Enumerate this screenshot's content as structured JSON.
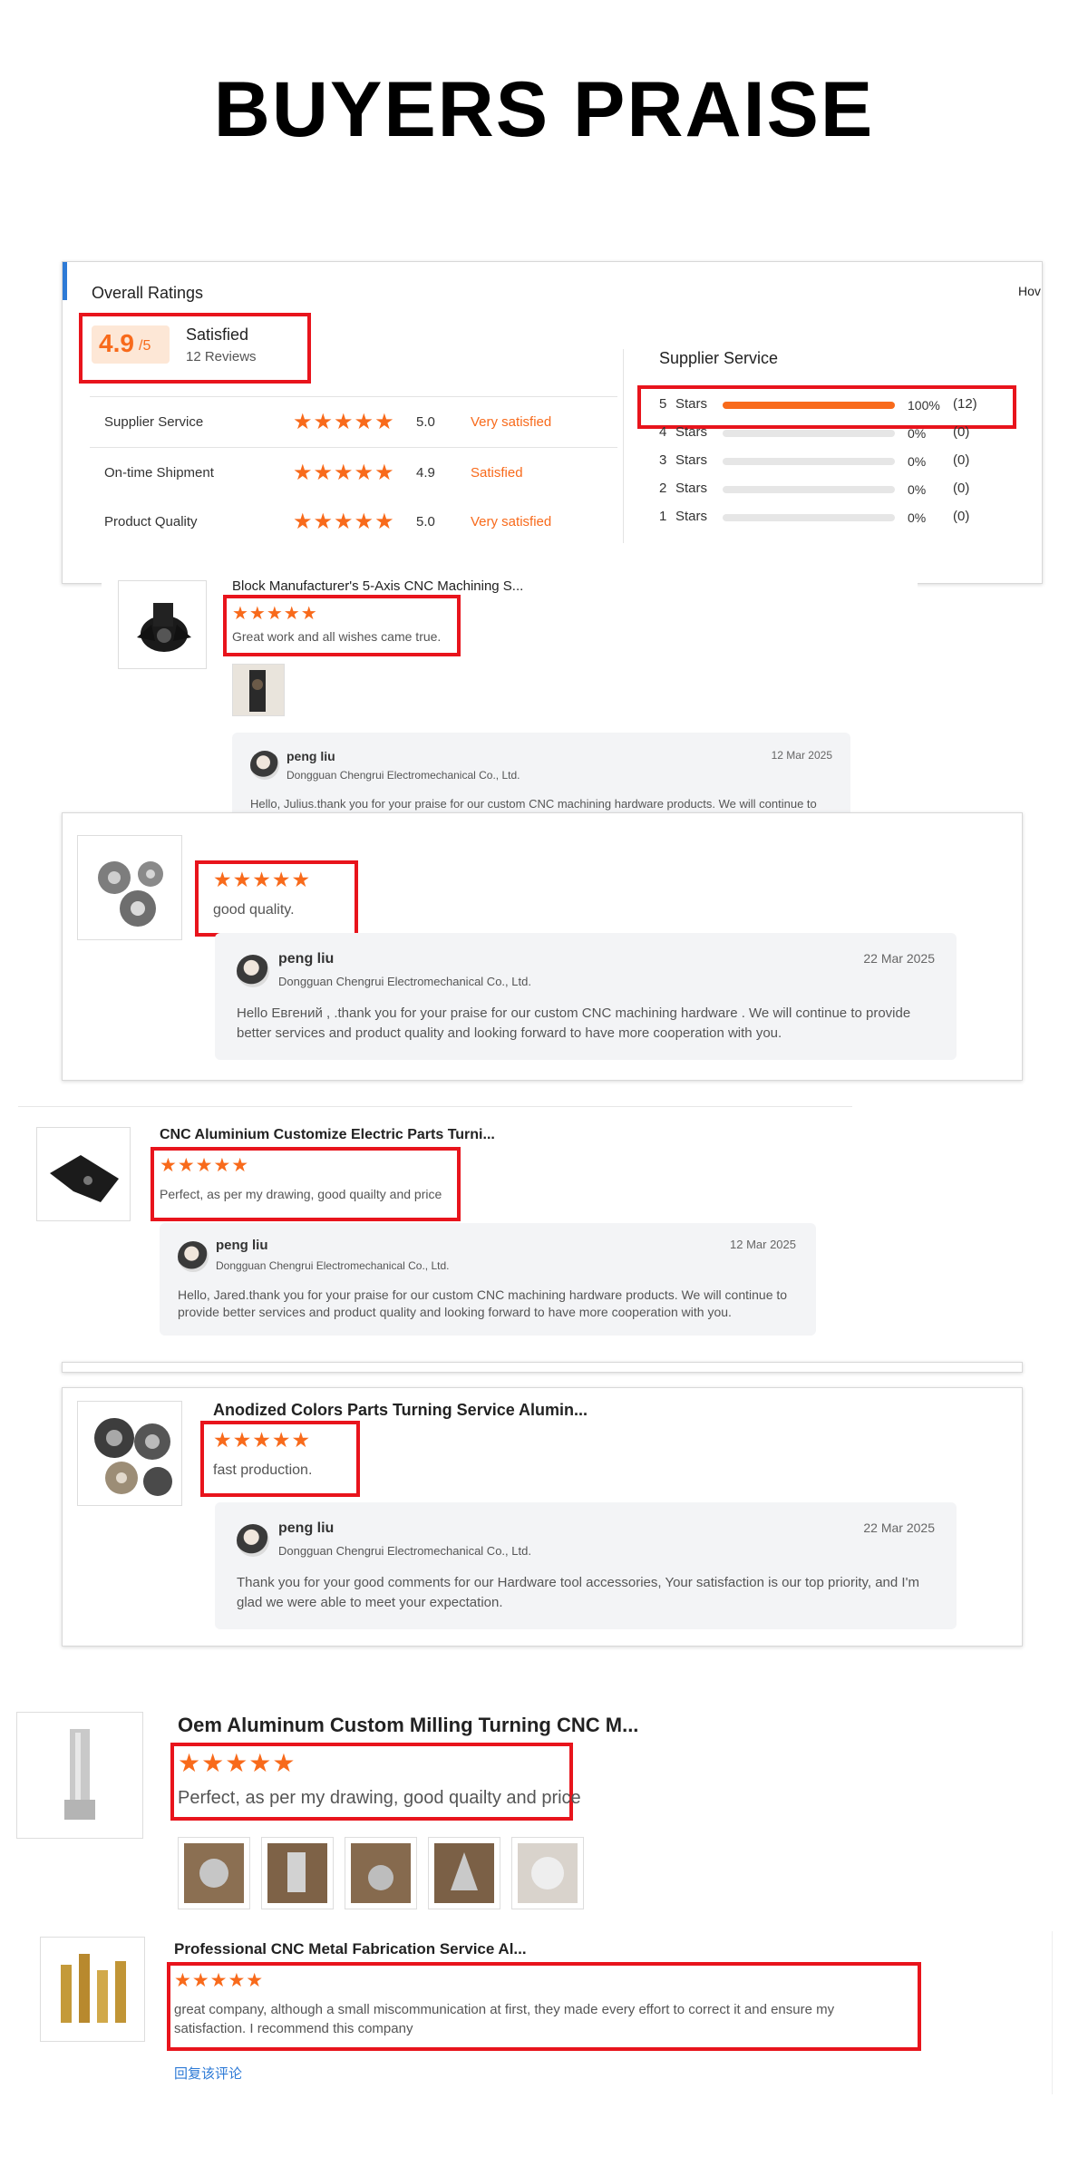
{
  "header": {
    "title": "BUYERS PRAISE"
  },
  "ratings": {
    "heading": "Overall Ratings",
    "score": "4.9",
    "score_suffix": "/5",
    "label": "Satisfied",
    "reviews": "12 Reviews",
    "how_cut": "Hov",
    "rows": [
      {
        "name": "Supplier Service",
        "stars": "★★★★★",
        "value": "5.0",
        "status": "Very satisfied"
      },
      {
        "name": "On-time Shipment",
        "stars": "★★★★★",
        "value": "4.9",
        "status": "Satisfied"
      },
      {
        "name": "Product Quality",
        "stars": "★★★★★",
        "value": "5.0",
        "status": "Very satisfied"
      }
    ],
    "supplier": {
      "heading": "Supplier Service",
      "rows": [
        {
          "stars": "5",
          "label": "Stars",
          "percent": "100%",
          "count": "(12)",
          "fill": 1.0
        },
        {
          "stars": "4",
          "label": "Stars",
          "percent": "0%",
          "count": "(0)",
          "fill": 0
        },
        {
          "stars": "3",
          "label": "Stars",
          "percent": "0%",
          "count": "(0)",
          "fill": 0
        },
        {
          "stars": "2",
          "label": "Stars",
          "percent": "0%",
          "count": "(0)",
          "fill": 0
        },
        {
          "stars": "1",
          "label": "Stars",
          "percent": "0%",
          "count": "(0)",
          "fill": 0
        }
      ]
    }
  },
  "reviews": [
    {
      "product": "Block Manufacturer's 5-Axis CNC Machining S...",
      "stars": "★★★★★",
      "text": "Great work and all wishes came true.",
      "reply": {
        "name": "peng liu",
        "company": "Dongguan Chengrui Electromechanical Co., Ltd.",
        "date": "12 Mar 2025",
        "text": "Hello, Julius.thank you for your praise for our custom CNC machining hardware products. We will continue to provide better services and product quality and looking forward to have more cooperation with you."
      }
    },
    {
      "stars": "★★★★★",
      "text": "good quality.",
      "reply": {
        "name": "peng liu",
        "company": "Dongguan Chengrui Electromechanical Co., Ltd.",
        "date": "22 Mar 2025",
        "text": "Hello Евгений , .thank you for your praise for our custom CNC machining hardware . We will continue to provide better services and product quality and looking forward to have more cooperation with you."
      }
    },
    {
      "product": "CNC Aluminium Customize Electric Parts Turni...",
      "stars": "★★★★★",
      "text": "Perfect, as per my drawing, good quailty and price",
      "reply": {
        "name": "peng liu",
        "company": "Dongguan Chengrui Electromechanical Co., Ltd.",
        "date": "12 Mar 2025",
        "text": "Hello, Jared.thank you for your praise for our custom CNC machining hardware products. We will continue to provide better services and product quality and looking forward to have more cooperation with you."
      }
    },
    {
      "product": "Anodized Colors Parts Turning Service Alumin...",
      "stars": "★★★★★",
      "text": "fast production.",
      "reply": {
        "name": "peng liu",
        "company": "Dongguan Chengrui Electromechanical Co., Ltd.",
        "date": "22 Mar 2025",
        "text": "Thank you for your good comments for our Hardware tool accessories, Your satisfaction is our top priority, and I'm glad we were able to meet your expectation."
      }
    },
    {
      "product": "Oem Aluminum Custom Milling Turning CNC M...",
      "stars": "★★★★★",
      "text": "Perfect, as per my drawing, good quailty and price"
    },
    {
      "product": "Professional CNC Metal Fabrication Service Al...",
      "stars": "★★★★★",
      "text": "great company, although a small miscommunication at first, they made every effort to correct it and ensure my satisfaction. I recommend this company",
      "link": "回复该评论"
    }
  ]
}
